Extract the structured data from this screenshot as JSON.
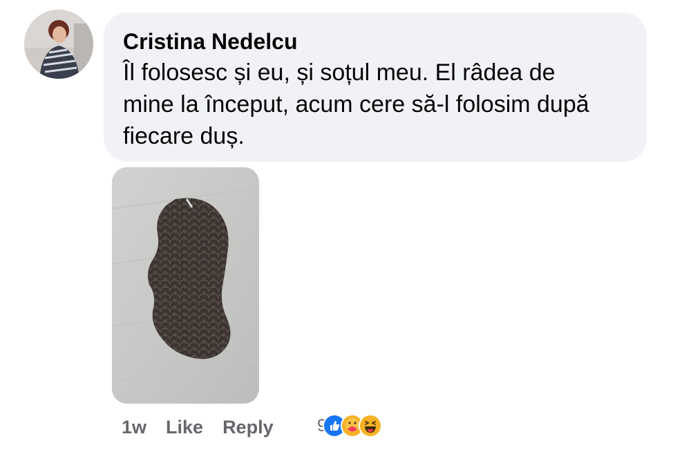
{
  "comment": {
    "author": "Cristina Nedelcu",
    "text": "Îl folosesc și eu, și soțul meu. El râdea de mine la început, acum cere să-l folosim după fiecare duș.",
    "avatar_icon": "profile-photo",
    "attachment_icon": "photo-attachment"
  },
  "actions": {
    "time": "1w",
    "like_label": "Like",
    "reply_label": "Reply"
  },
  "reactions": {
    "count": "9",
    "types": [
      "like-icon",
      "care-icon",
      "haha-icon"
    ],
    "colors": {
      "like": "#1877f2",
      "care": "#f33e58",
      "haha": "#f7b125"
    }
  },
  "colors": {
    "bubble": "#f0f2f5",
    "text": "#050505",
    "secondary_text": "#65676b"
  }
}
